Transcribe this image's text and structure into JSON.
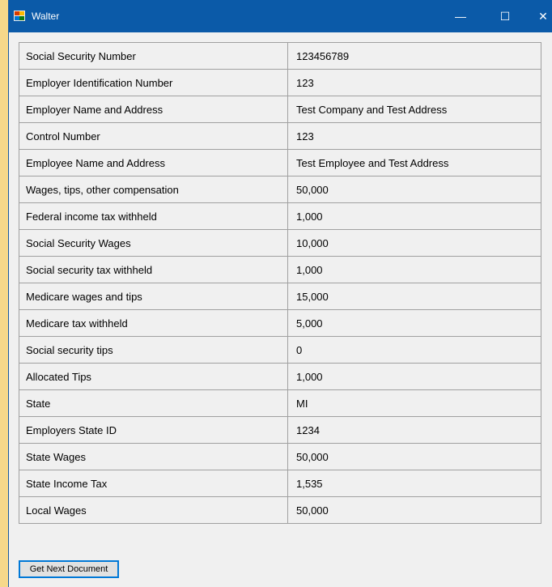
{
  "window": {
    "title": "Walter",
    "minimize_glyph": "—",
    "maximize_glyph": "☐",
    "close_glyph": "✕"
  },
  "table": {
    "rows": [
      {
        "label": "Social Security Number",
        "value": "123456789"
      },
      {
        "label": "Employer Identification Number",
        "value": "123"
      },
      {
        "label": "Employer Name and Address",
        "value": "Test Company and Test Address"
      },
      {
        "label": "Control Number",
        "value": "123"
      },
      {
        "label": "Employee Name and Address",
        "value": "Test Employee and Test Address"
      },
      {
        "label": "Wages, tips, other compensation",
        "value": "50,000"
      },
      {
        "label": "Federal income tax withheld",
        "value": "1,000"
      },
      {
        "label": "Social Security Wages",
        "value": "10,000"
      },
      {
        "label": "Social security tax withheld",
        "value": "1,000"
      },
      {
        "label": "Medicare wages and tips",
        "value": "15,000"
      },
      {
        "label": "Medicare tax withheld",
        "value": "5,000"
      },
      {
        "label": "Social security tips",
        "value": "0"
      },
      {
        "label": "Allocated Tips",
        "value": "1,000"
      },
      {
        "label": "State",
        "value": "MI"
      },
      {
        "label": "Employers State ID",
        "value": "1234"
      },
      {
        "label": "State Wages",
        "value": "50,000"
      },
      {
        "label": "State Income Tax",
        "value": "1,535"
      },
      {
        "label": "Local Wages",
        "value": "50,000"
      }
    ]
  },
  "actions": {
    "next_label": "Get Next Document"
  },
  "colors": {
    "titlebar": "#0b5aa8",
    "background": "#f6d88a",
    "window": "#f0f0f0"
  }
}
